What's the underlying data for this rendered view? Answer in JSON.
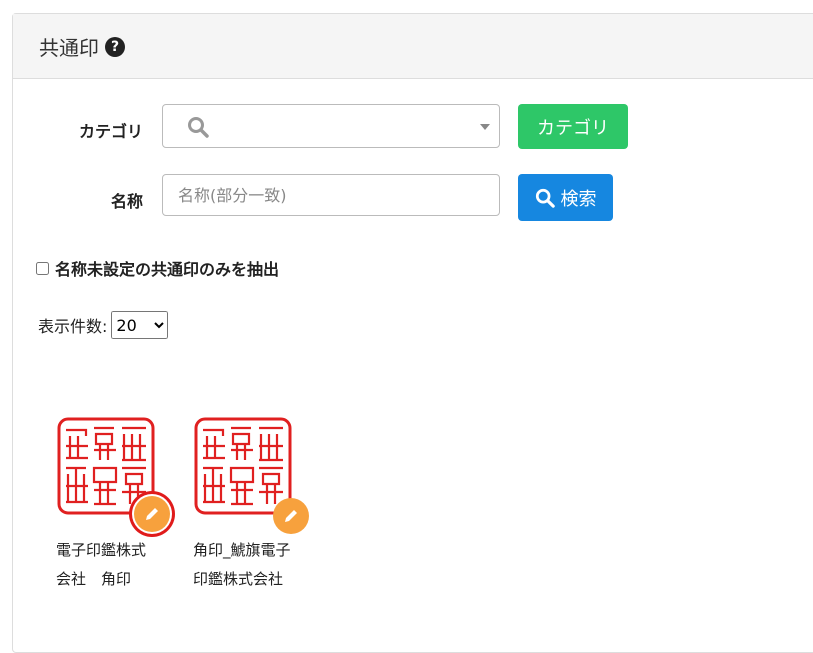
{
  "panel": {
    "title": "共通印"
  },
  "form": {
    "category_label": "カテゴリ",
    "category_button": "カテゴリ",
    "name_label": "名称",
    "name_placeholder": "名称(部分一致)",
    "search_button": "検索",
    "checkbox_label": "名称未設定の共通印のみを抽出",
    "per_page_label": "表示件数:",
    "per_page_value": "20"
  },
  "seals": [
    {
      "name": "電子印鑑株式会社　角印",
      "seal_text": [
        "鯱旗電子印鑑株式会社之印"
      ]
    },
    {
      "name": "角印_鯱旗電子印鑑株式会社",
      "seal_text": [
        "鯱旗電子印鑑株式会社之印"
      ]
    }
  ],
  "colors": {
    "accent_green": "#2ec768",
    "accent_blue": "#1687e0",
    "edit_orange": "#f7a13d",
    "seal_red": "#e02020"
  }
}
